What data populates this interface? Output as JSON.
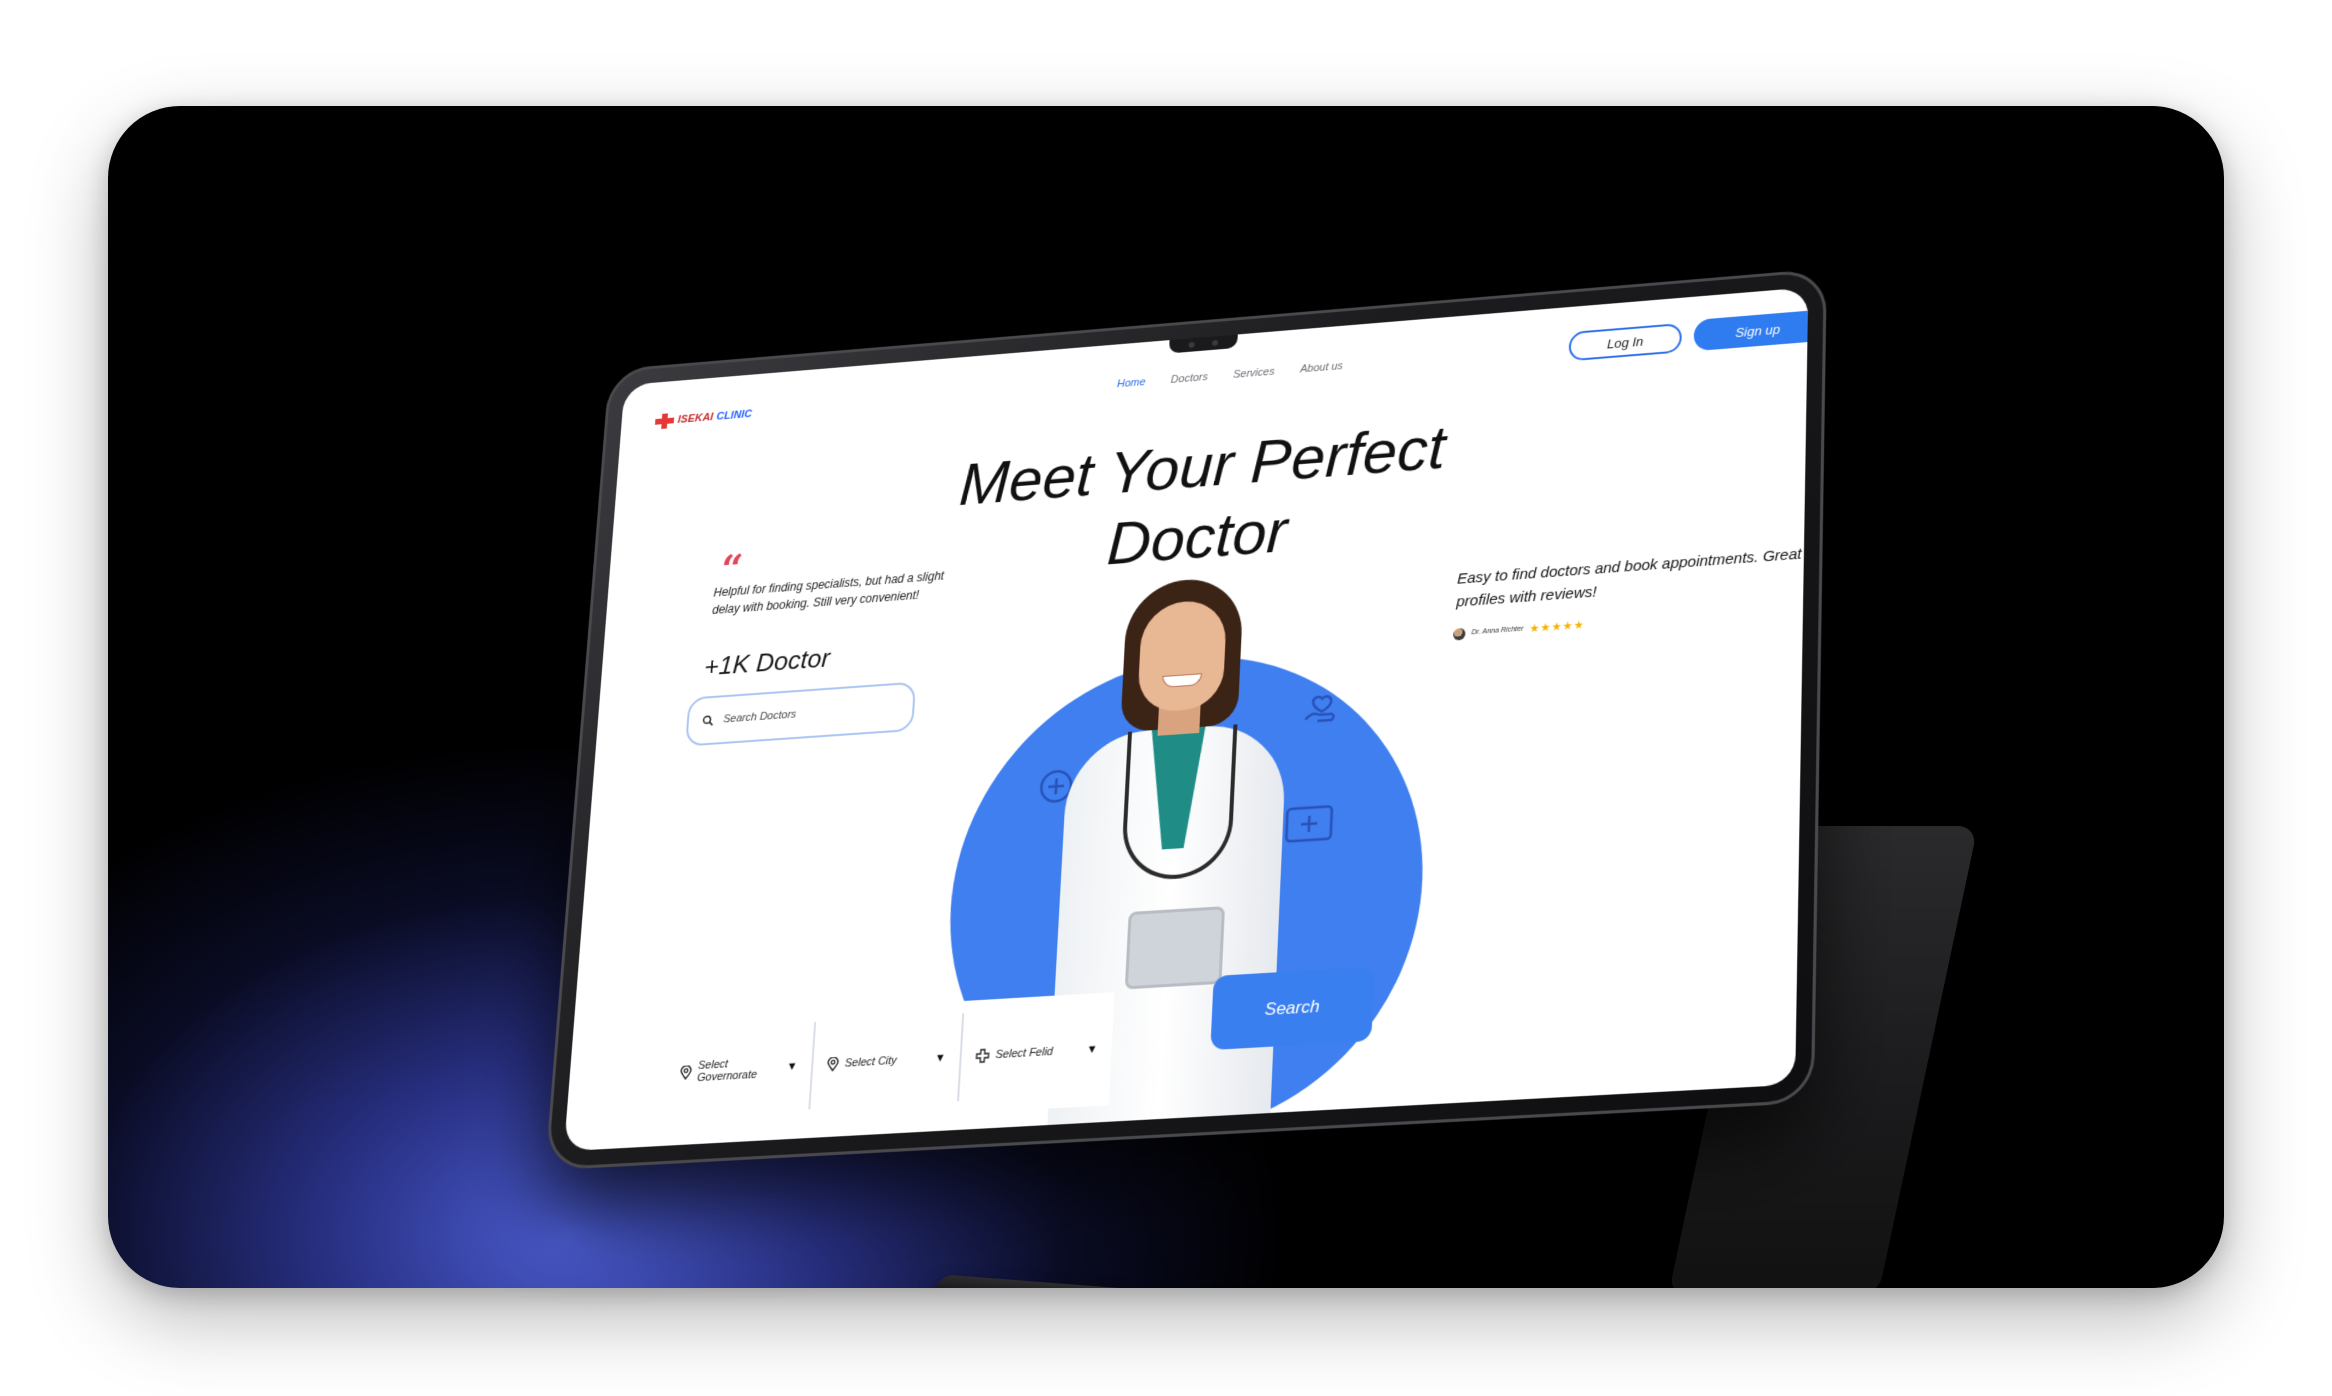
{
  "brand": {
    "logo_text_a": "ISEKAI",
    "logo_text_b": " CLINIC"
  },
  "nav": {
    "links": [
      "Home",
      "Doctors",
      "Services",
      "About us"
    ],
    "active": "Home",
    "login_label": "Log In",
    "signup_label": "Sign up"
  },
  "hero": {
    "title_line1": "Meet Your Perfect",
    "title_line2": "Doctor",
    "quote_text": "Helpful for finding specialists, but had a slight delay with booking. Still very convenient!",
    "stat": "+1K Doctor",
    "search_placeholder": "Search Doctors",
    "review_text": "Easy to find doctors and book appointments. Great profiles with reviews!",
    "reviewer_name": "Dr. Anna Richter",
    "stars": "★★★★★"
  },
  "filters": {
    "governorate": "Select Governorate",
    "city": "Select City",
    "field": "Select Felid",
    "search_label": "Search"
  },
  "colors": {
    "accent": "#2f7bf0",
    "logo_red": "#c62828",
    "quote_red": "#e0455a",
    "star": "#f5b400"
  }
}
